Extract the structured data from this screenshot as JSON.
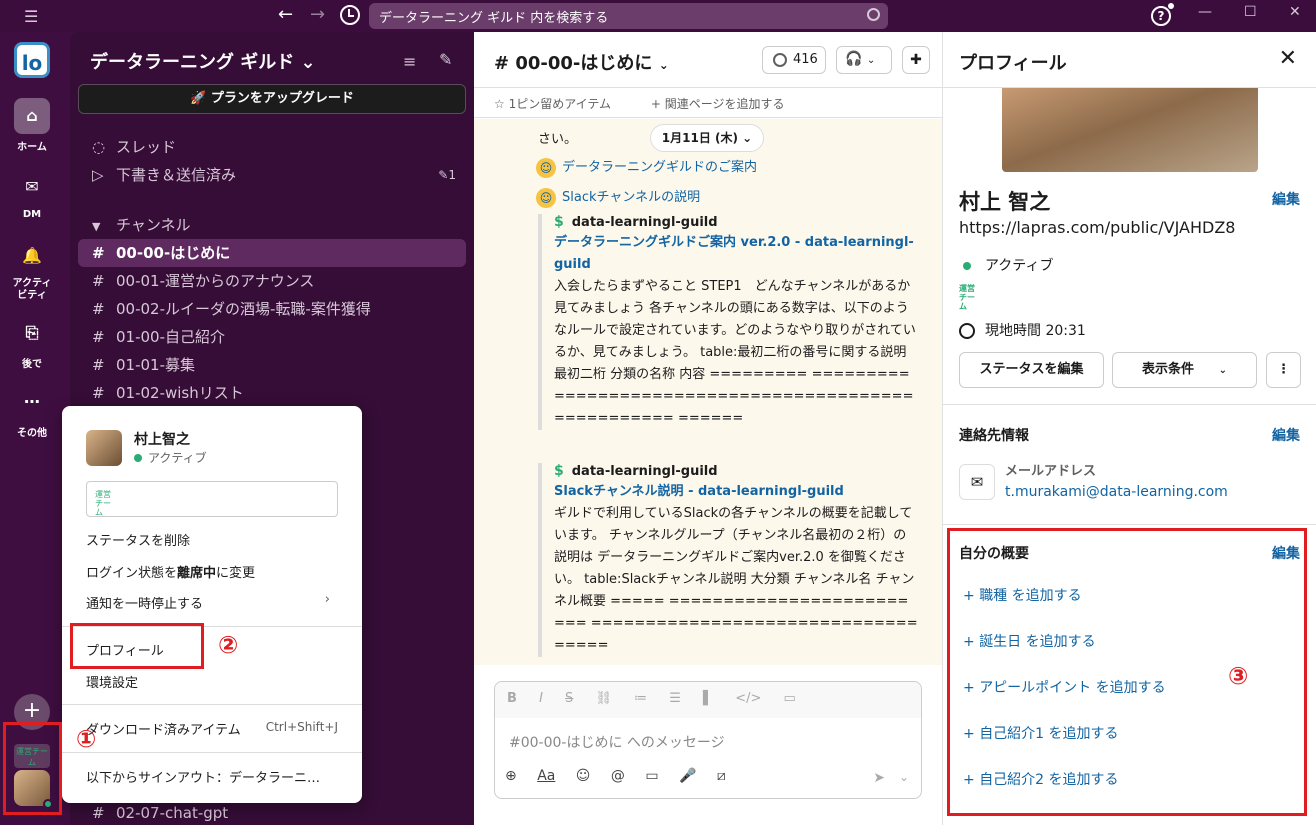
{
  "topbar": {
    "search_placeholder": "データラーニング ギルド 内を検索する",
    "help": "?"
  },
  "rail": {
    "logo": "lo",
    "items": [
      {
        "label": "ホーム"
      },
      {
        "label": "DM"
      },
      {
        "label": "アクティビティ"
      },
      {
        "label": "後で"
      },
      {
        "label": "その他"
      }
    ],
    "ws2_text": "運営チーム"
  },
  "sidebar": {
    "workspace_name": "データラーニング ギルド",
    "upgrade_label": "プランをアップグレード",
    "threads": "スレッド",
    "drafts": "下書き＆送信済み",
    "drafts_badge": "1",
    "channels_header": "チャンネル",
    "channels": [
      "00-00-はじめに",
      "00-01-運営からのアナウンス",
      "00-02-ルイーダの酒場-転職-案件獲得",
      "01-00-自己紹介",
      "01-01-募集",
      "01-02-wishリスト"
    ],
    "bottom_channel": "02-07-chat-gpt"
  },
  "popup": {
    "user_name": "村上智之",
    "status": "アクティブ",
    "status_input_text": "運営チーム",
    "clear_status": "ステータスを削除",
    "away_prefix": "ログイン状態を",
    "away_bold": "離席中",
    "away_suffix": "に変更",
    "pause": "通知を一時停止する",
    "profile": "プロフィール",
    "prefs": "環境設定",
    "downloads": "ダウンロード済みアイテム",
    "downloads_shortcut": "Ctrl+Shift+J",
    "signout": "以下からサインアウト：データラーニ…"
  },
  "annotations": {
    "one": "①",
    "two": "②",
    "three": "③"
  },
  "channel": {
    "name": "00-00-はじめに",
    "member_count": "416",
    "pinned": "1ピン留めアイテム",
    "add_page": "関連ページを追加する",
    "date": "1月11日 (木)",
    "msg_tail": "さい。",
    "link1": "データラーニングギルドのご案内",
    "link2": "Slackチャンネルの説明",
    "att1_source": "data-learningl-guild",
    "att1_title": "データラーニングギルドご案内 ver.2.0 - data-learningl-guild",
    "att1_body": "入会したらまずやること STEP1　どんなチャンネルがあるか見てみましょう 各チャンネルの頭にある数字は、以下のようなルールで設定されています。どのようなやり取りがされているか、見てみましょう。 table:最初二桁の番号に関する説明 最初二桁 分類の名称 内容 ========= ========= ============================================ ======",
    "att2_source": "data-learningl-guild",
    "att2_title": "Slackチャンネル説明 - data-learningl-guild",
    "att2_body": "ギルドで利用しているSlackの各チャンネルの概要を記載しています。 チャンネルグループ（チャンネル名最初の２桁）の説明は データラーニングギルドご案内ver.2.0 を御覧ください。 table:Slackチャンネル説明 大分類 チャンネル名 チャンネル概要 ===== ========================= ===================================",
    "composer_placeholder": "#00-00-はじめに へのメッセージ"
  },
  "profile": {
    "title": "プロフィール",
    "name": "村上 智之",
    "edit": "編集",
    "url": "https://lapras.com/public/VJAHDZ8",
    "status": "アクティブ",
    "team": "運営チーム",
    "local_time": "現地時間 20:31",
    "btn_status": "ステータスを編集",
    "btn_view": "表示条件",
    "contact_header": "連絡先情報",
    "email_label": "メールアドレス",
    "email": "t.murakami@data-learning.com",
    "about_header": "自分の概要",
    "add_items": [
      "職種 を追加する",
      "誕生日 を追加する",
      "アピールポイント を追加する",
      "自己紹介1 を追加する",
      "自己紹介2 を追加する"
    ]
  },
  "colors": {
    "aubergine": "#3f0e40",
    "link": "#1264a3",
    "online": "#2bac76",
    "annotation": "#e01e22"
  }
}
